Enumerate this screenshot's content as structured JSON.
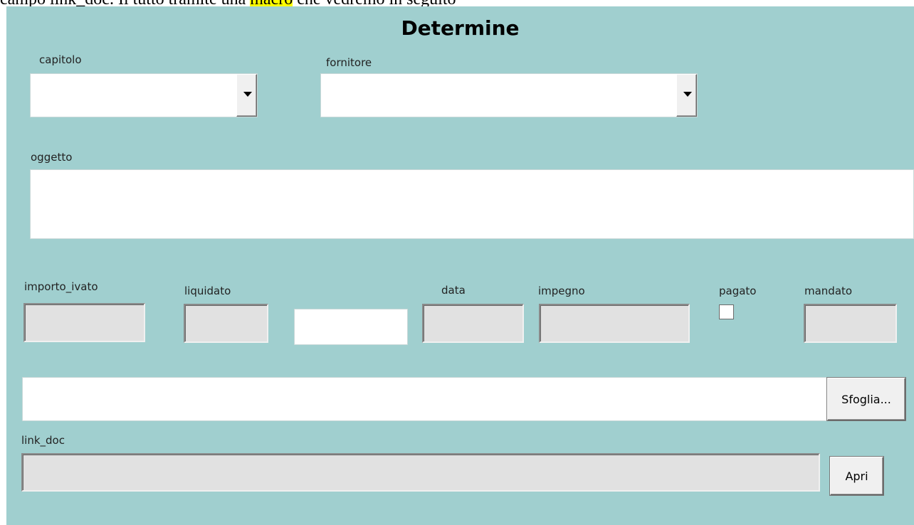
{
  "caption": {
    "before": "campo link_doc. Il tutto tramite una ",
    "highlight": "macro",
    "after": " che vedremo in seguito"
  },
  "form": {
    "title": "Determine",
    "fields": {
      "capitolo": {
        "label": "capitolo",
        "value": ""
      },
      "fornitore": {
        "label": "fornitore",
        "value": ""
      },
      "oggetto": {
        "label": "oggetto",
        "value": ""
      },
      "importo_ivato": {
        "label": "importo_ivato",
        "value": ""
      },
      "liquidato": {
        "label": "liquidato",
        "value": ""
      },
      "unlabeled": {
        "value": ""
      },
      "data": {
        "label": "data",
        "value": ""
      },
      "impegno": {
        "label": "impegno",
        "value": ""
      },
      "pagato": {
        "label": "pagato",
        "checked": false
      },
      "mandato": {
        "label": "mandato",
        "value": ""
      },
      "file_path": {
        "value": ""
      },
      "link_doc": {
        "label": "link_doc",
        "value": ""
      }
    },
    "buttons": {
      "browse": "Sfoglia...",
      "open": "Apri"
    },
    "colors": {
      "background": "#a0cfcf",
      "disabled_field": "#e1e1e1",
      "highlight": "#ffff00"
    }
  }
}
